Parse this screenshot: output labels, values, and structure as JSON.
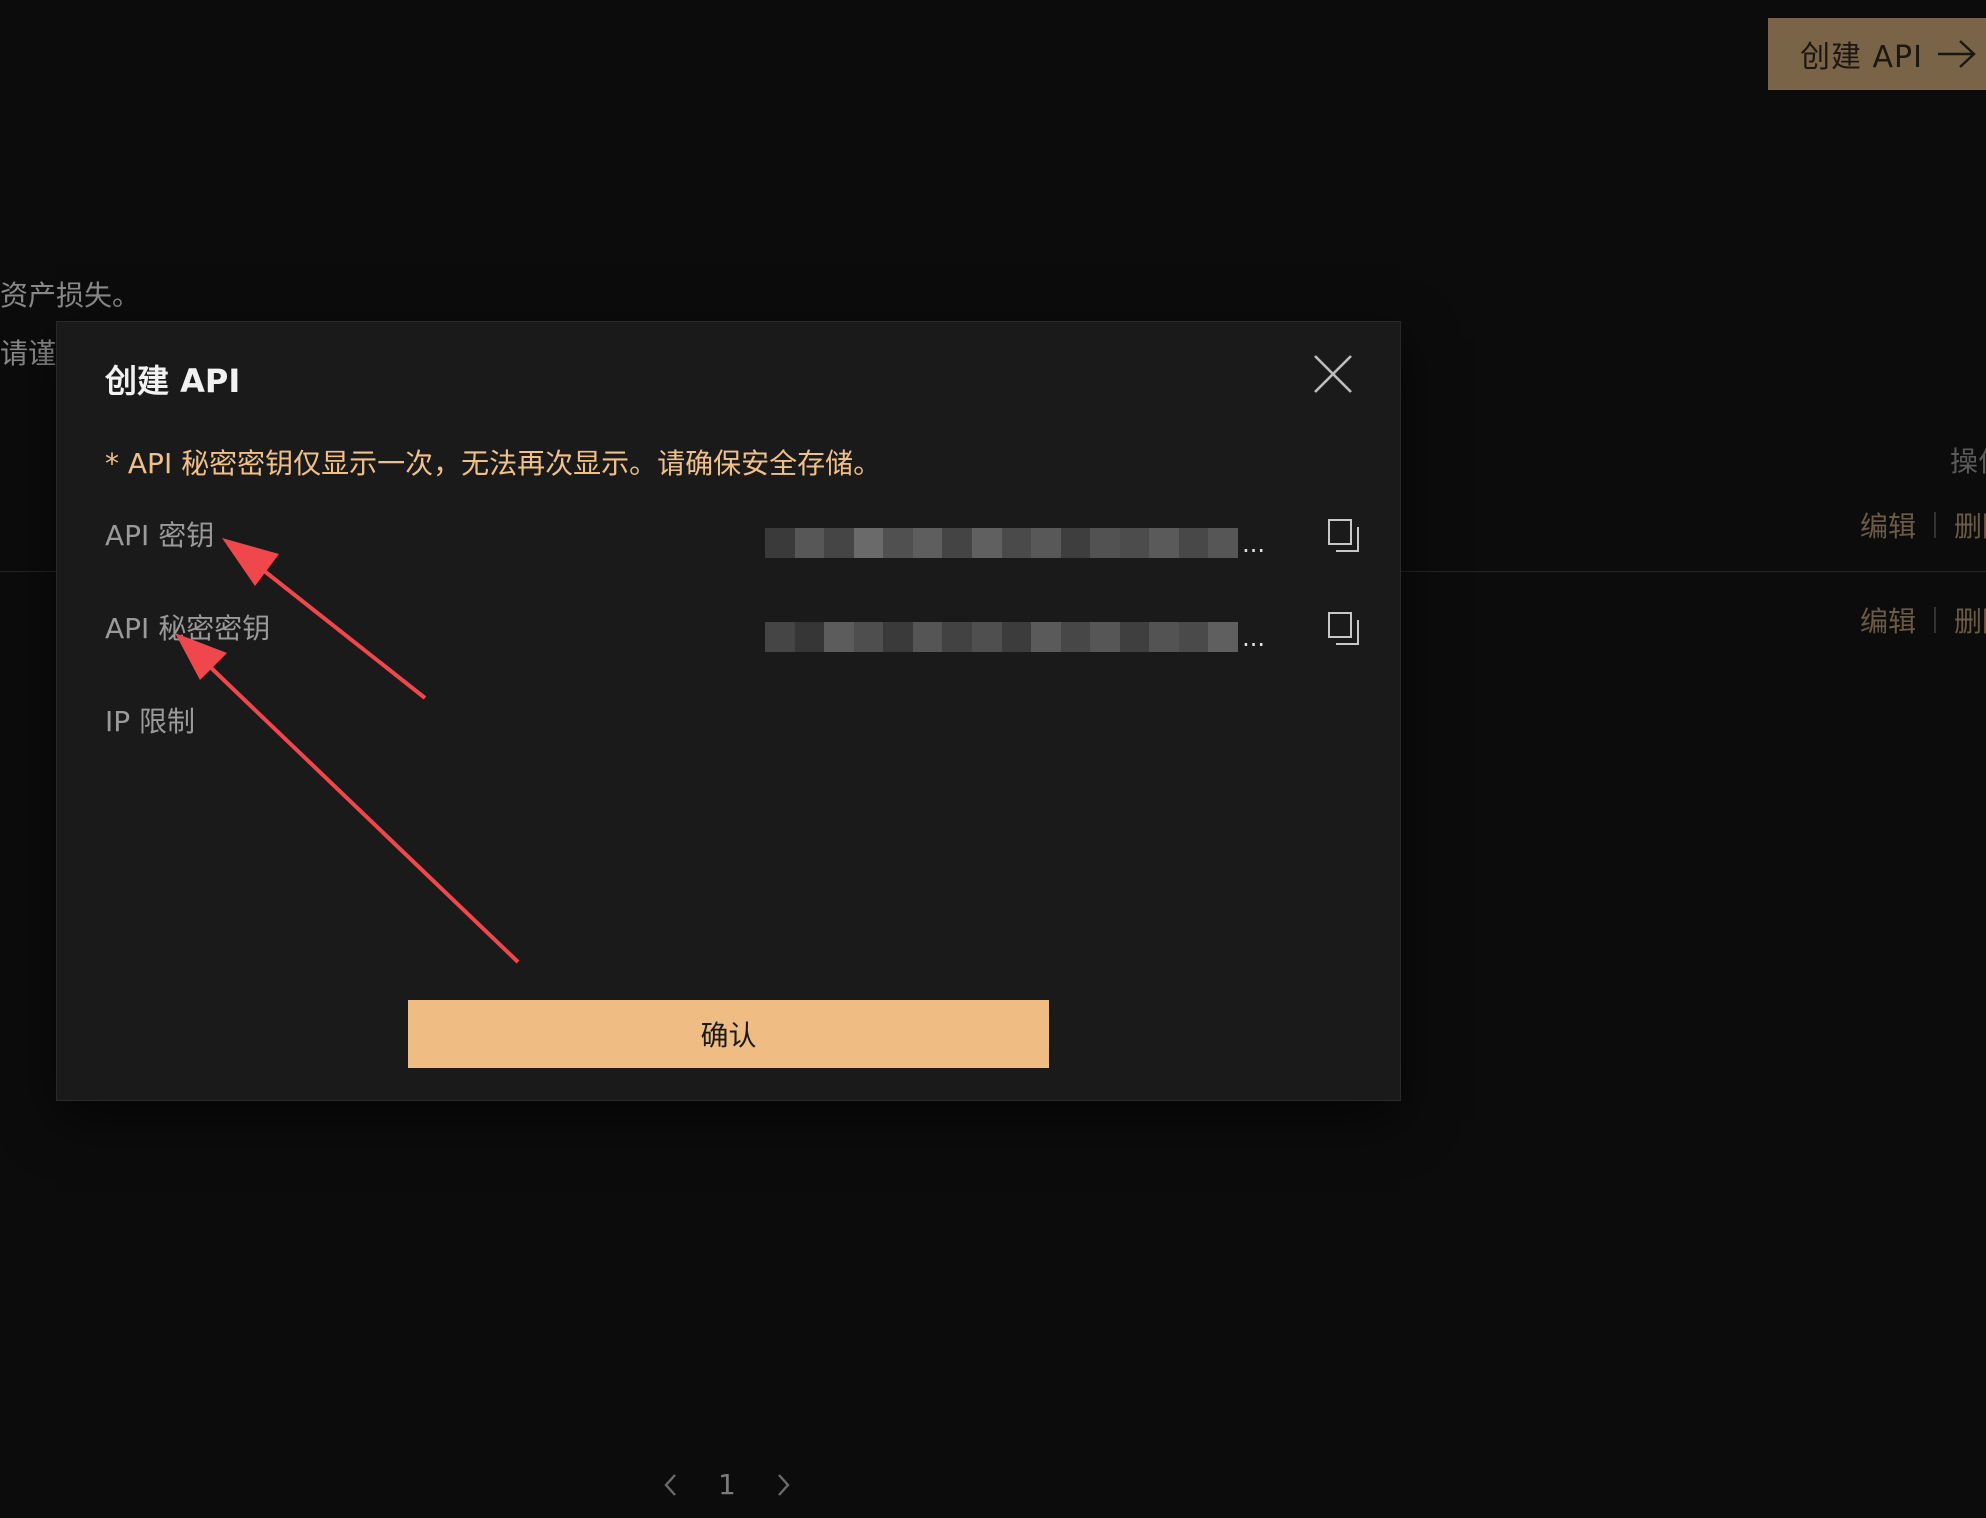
{
  "background": {
    "create_button_label": "创建 API",
    "warning_line_1": "资产损失。",
    "warning_line_2": "请谨慎",
    "column_header_fragment": "操作",
    "row_actions": [
      {
        "edit": "编辑",
        "delete": "删除"
      },
      {
        "edit": "编辑",
        "delete": "删除"
      }
    ],
    "pagination": {
      "current_page": "1"
    }
  },
  "modal": {
    "title": "创建 API",
    "notice": "* API 秘密密钥仅显示一次，无法再次显示。请确保安全存储。",
    "fields": [
      {
        "label": "API 密钥",
        "value_suffix": "..."
      },
      {
        "label": "API 秘密密钥",
        "value_suffix": "..."
      },
      {
        "label": "IP 限制"
      }
    ],
    "confirm_label": "确认"
  },
  "colors": {
    "accent": "#efbd84",
    "notice": "#f0c089",
    "annotation_arrow": "#f0474c",
    "top_button": "#7a6448"
  }
}
